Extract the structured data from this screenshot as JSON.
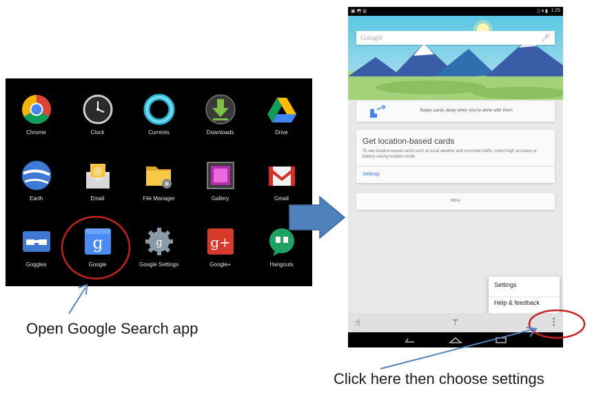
{
  "drawer": {
    "apps": [
      {
        "label": "Chrome",
        "icon": "chrome-icon"
      },
      {
        "label": "Clock",
        "icon": "clock-icon"
      },
      {
        "label": "Currents",
        "icon": "currents-icon"
      },
      {
        "label": "Downloads",
        "icon": "downloads-icon"
      },
      {
        "label": "Drive",
        "icon": "drive-icon"
      },
      {
        "label": "Earth",
        "icon": "earth-icon"
      },
      {
        "label": "Email",
        "icon": "email-icon"
      },
      {
        "label": "File Manager",
        "icon": "file-manager-icon"
      },
      {
        "label": "Gallery",
        "icon": "gallery-icon"
      },
      {
        "label": "Gmail",
        "icon": "gmail-icon"
      },
      {
        "label": "Goggles",
        "icon": "goggles-icon"
      },
      {
        "label": "Google",
        "icon": "google-icon"
      },
      {
        "label": "Google Settings",
        "icon": "google-settings-icon"
      },
      {
        "label": "Google+",
        "icon": "google-plus-icon"
      },
      {
        "label": "Hangouts",
        "icon": "hangouts-icon"
      }
    ]
  },
  "phone": {
    "status_time": "1:25",
    "search_placeholder": "Google",
    "swipe_hint": "Swipe cards away when you're done with them",
    "location_card": {
      "title": "Get location-based cards",
      "body": "To see location-based cards such as local weather and commute traffic, select high accuracy or battery saving location mode",
      "link": "Settings"
    },
    "more_label": "More",
    "menu": {
      "settings": "Settings",
      "help": "Help & feedback"
    }
  },
  "annotations": {
    "open_app": "Open Google Search app",
    "click_here": "Click here then choose settings"
  },
  "colors": {
    "annotation_red": "#c8201e",
    "annotation_blue": "#4f81bd",
    "google_blue": "#4a8af4"
  }
}
